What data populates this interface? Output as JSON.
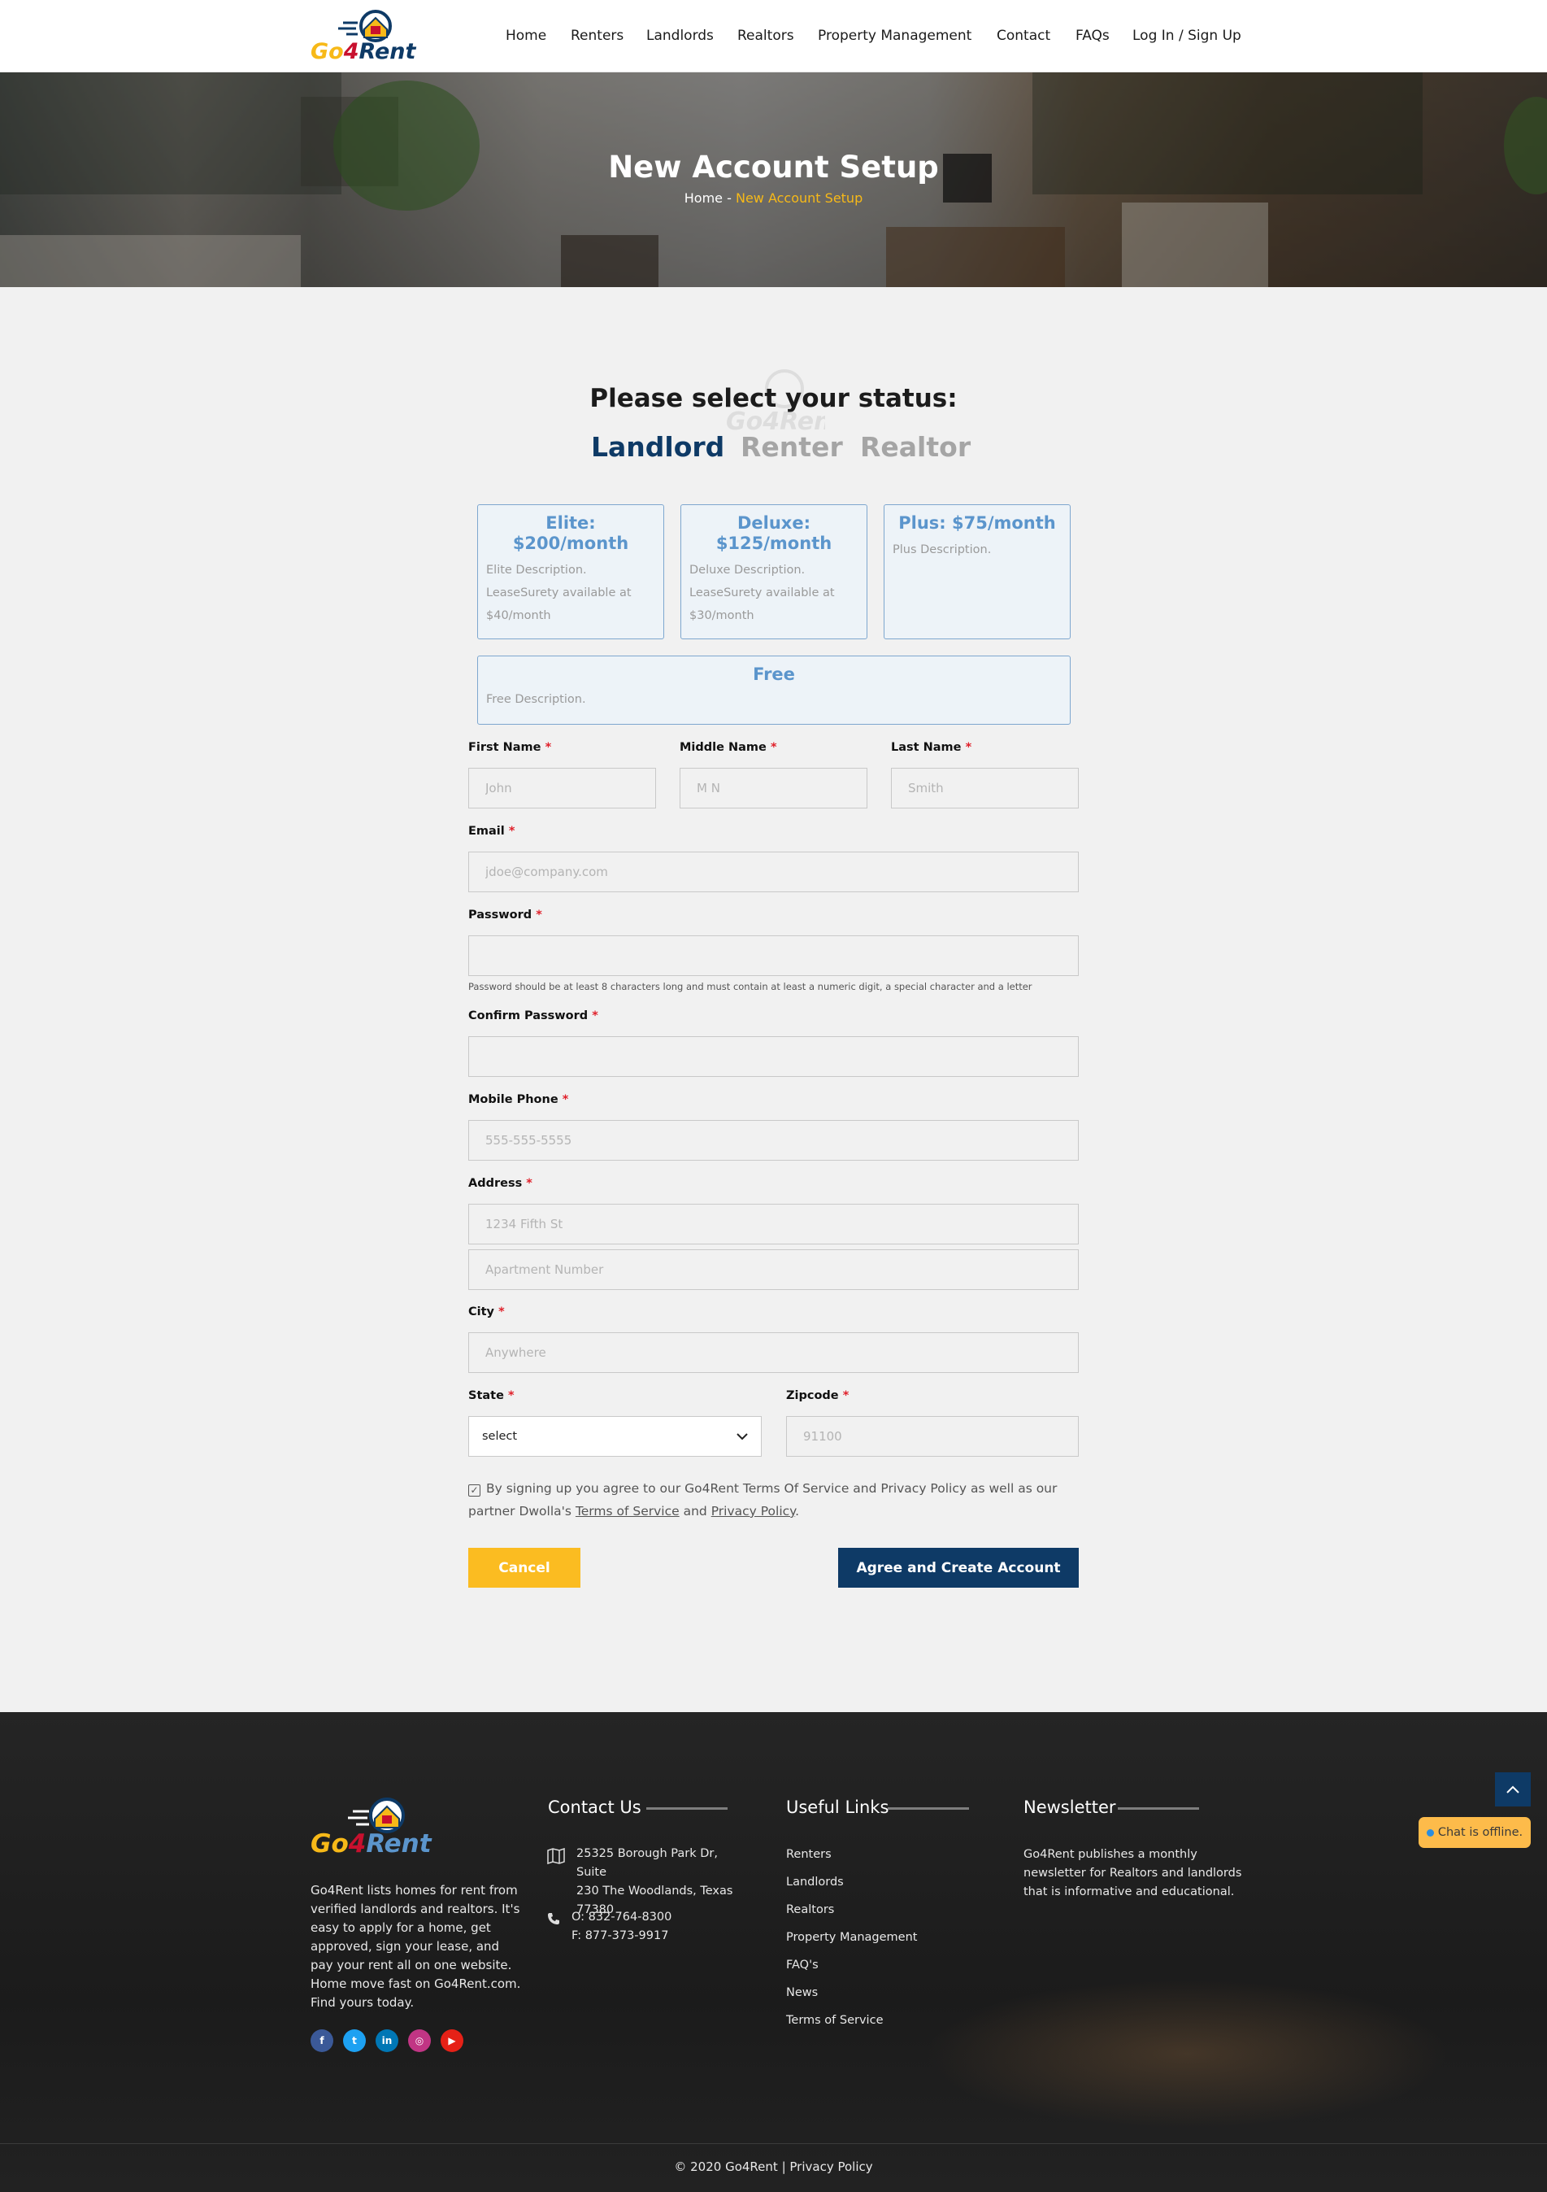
{
  "brand": {
    "logo_text_a": "Go",
    "logo_text_b": "4",
    "logo_text_c": "Rent"
  },
  "nav": [
    "Home",
    "Renters",
    "Landlords",
    "Realtors",
    "Property Management",
    "Contact",
    "FAQs",
    "Log In / Sign Up"
  ],
  "hero": {
    "title": "New Account Setup",
    "crumb_home": "Home",
    "crumb_sep": "-",
    "crumb_current": "New Account Setup"
  },
  "status": {
    "question": "Please select your status:",
    "roles": [
      "Landlord",
      "Renter",
      "Realtor"
    ],
    "selected": "Landlord"
  },
  "plans": [
    {
      "title": "Elite: $200/month",
      "desc": "Elite Description. LeaseSurety available at $40/month"
    },
    {
      "title": "Deluxe: $125/month",
      "desc": "Deluxe Description. LeaseSurety available at $30/month"
    },
    {
      "title": "Plus: $75/month",
      "desc": "Plus Description."
    },
    {
      "title": "Free",
      "desc": "Free Description."
    }
  ],
  "form": {
    "required_mark": "*",
    "first_name": {
      "label": "First Name",
      "placeholder": "John"
    },
    "middle_name": {
      "label": "Middle Name",
      "placeholder": "M N"
    },
    "last_name": {
      "label": "Last Name",
      "placeholder": "Smith"
    },
    "email": {
      "label": "Email",
      "placeholder": "jdoe@company.com"
    },
    "password": {
      "label": "Password",
      "placeholder": "",
      "hint": "Password should be at least 8 characters long and must contain at least a numeric digit, a special character and a letter"
    },
    "confirm_password": {
      "label": "Confirm Password",
      "placeholder": ""
    },
    "mobile": {
      "label": "Mobile Phone",
      "placeholder": "555-555-5555"
    },
    "address": {
      "label": "Address",
      "placeholder": "1234 Fifth St",
      "placeholder2": "Apartment Number"
    },
    "city": {
      "label": "City",
      "placeholder": "Anywhere"
    },
    "state": {
      "label": "State",
      "value": "select"
    },
    "zipcode": {
      "label": "Zipcode",
      "placeholder": "91100"
    },
    "agree_text_a": "By signing up you agree to our Go4Rent Terms Of Service and Privacy Policy as well as our partner Dwolla's",
    "agree_tos": "Terms of Service",
    "agree_and": "and",
    "agree_pp": "Privacy Policy",
    "agree_end": ".",
    "agree_checked": true,
    "cancel": "Cancel",
    "create": "Agree and Create Account"
  },
  "footer": {
    "about": "Go4Rent lists homes for rent from verified landlords and realtors. It's easy to apply for a home, get approved, sign your lease, and pay your rent all on one website. Home move fast on Go4Rent.com. Find yours today.",
    "contact_title": "Contact Us",
    "address_lines": [
      "25325 Borough Park Dr, Suite",
      "230 The Woodlands, Texas",
      "77380"
    ],
    "phone": "O: 832-764-8300",
    "fax": "F: 877-373-9917",
    "links_title": "Useful Links",
    "links": [
      "Renters",
      "Landlords",
      "Realtors",
      "Property Management",
      "FAQ's",
      "News",
      "Terms of Service"
    ],
    "newsletter_title": "Newsletter",
    "newsletter_text": "Go4Rent publishes a monthly newsletter for Realtors and landlords that is informative and educational.",
    "social": [
      {
        "icon": "facebook-icon",
        "glyph": "f",
        "color": "#3b5998"
      },
      {
        "icon": "twitter-icon",
        "glyph": "t",
        "color": "#1da1f2"
      },
      {
        "icon": "linkedin-icon",
        "glyph": "in",
        "color": "#0077b5"
      },
      {
        "icon": "instagram-icon",
        "glyph": "◎",
        "color": "#c13584"
      },
      {
        "icon": "youtube-icon",
        "glyph": "▶",
        "color": "#e62117"
      }
    ],
    "copyright": "© 2020 Go4Rent | Privacy Policy"
  },
  "chat": {
    "text": "Chat is offline."
  },
  "colors": {
    "navy": "#0e3a66",
    "gold": "#fbbc21",
    "plan_blue": "#5b95cc",
    "required_red": "#e0202a"
  }
}
